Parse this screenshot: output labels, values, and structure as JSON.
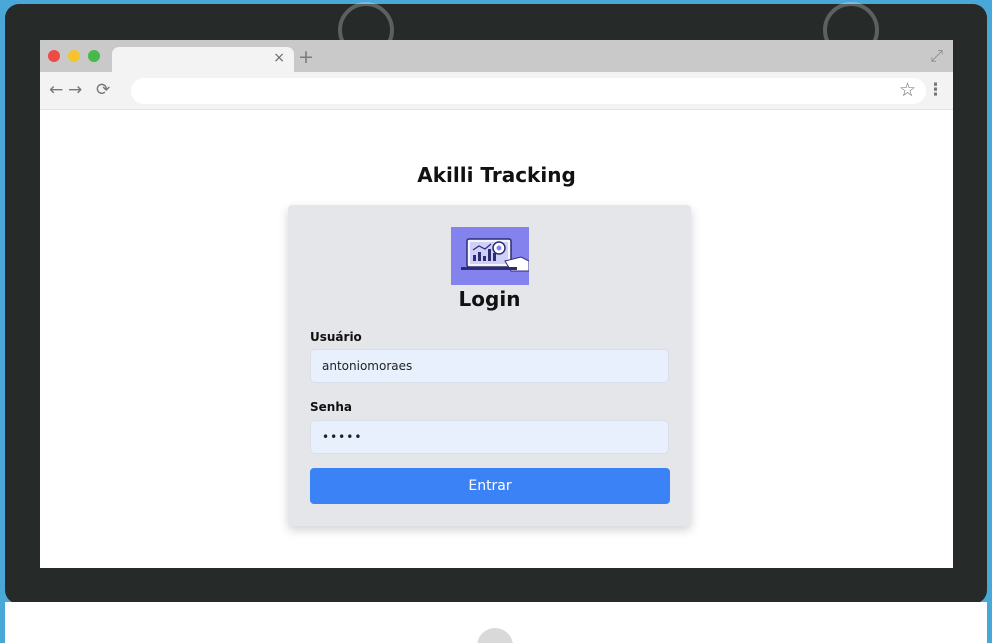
{
  "browser": {
    "tab_close": "×",
    "new_tab": "+",
    "expand": "⤢",
    "back": "←",
    "forward": "→",
    "reload": "⟳",
    "bookmark": "☆",
    "menu": "⋮",
    "traffic_lights": {
      "red": "#ee4b47",
      "yellow": "#f5c32c",
      "green": "#45b949"
    },
    "icons": {
      "tab_close": "close-icon",
      "new_tab": "plus-icon",
      "expand": "expand-icon",
      "back": "back-arrow-icon",
      "forward": "forward-arrow-icon",
      "reload": "reload-icon",
      "bookmark": "star-icon",
      "menu": "kebab-menu-icon"
    }
  },
  "page": {
    "title": "Akilli Tracking"
  },
  "login": {
    "heading": "Login",
    "logo_icon": "tracking-dashboard-logo-icon",
    "username_label": "Usuário",
    "username_value": "antoniomoraes",
    "password_label": "Senha",
    "password_value": "•••••",
    "submit_label": "Entrar"
  },
  "colors": {
    "accent": "#3b82f6",
    "card_bg": "#e5e6ea",
    "input_bg": "#e8f0fe",
    "logo_bg": "#8482ec",
    "monitor": "#262b29",
    "background": "#4aa8d8"
  }
}
